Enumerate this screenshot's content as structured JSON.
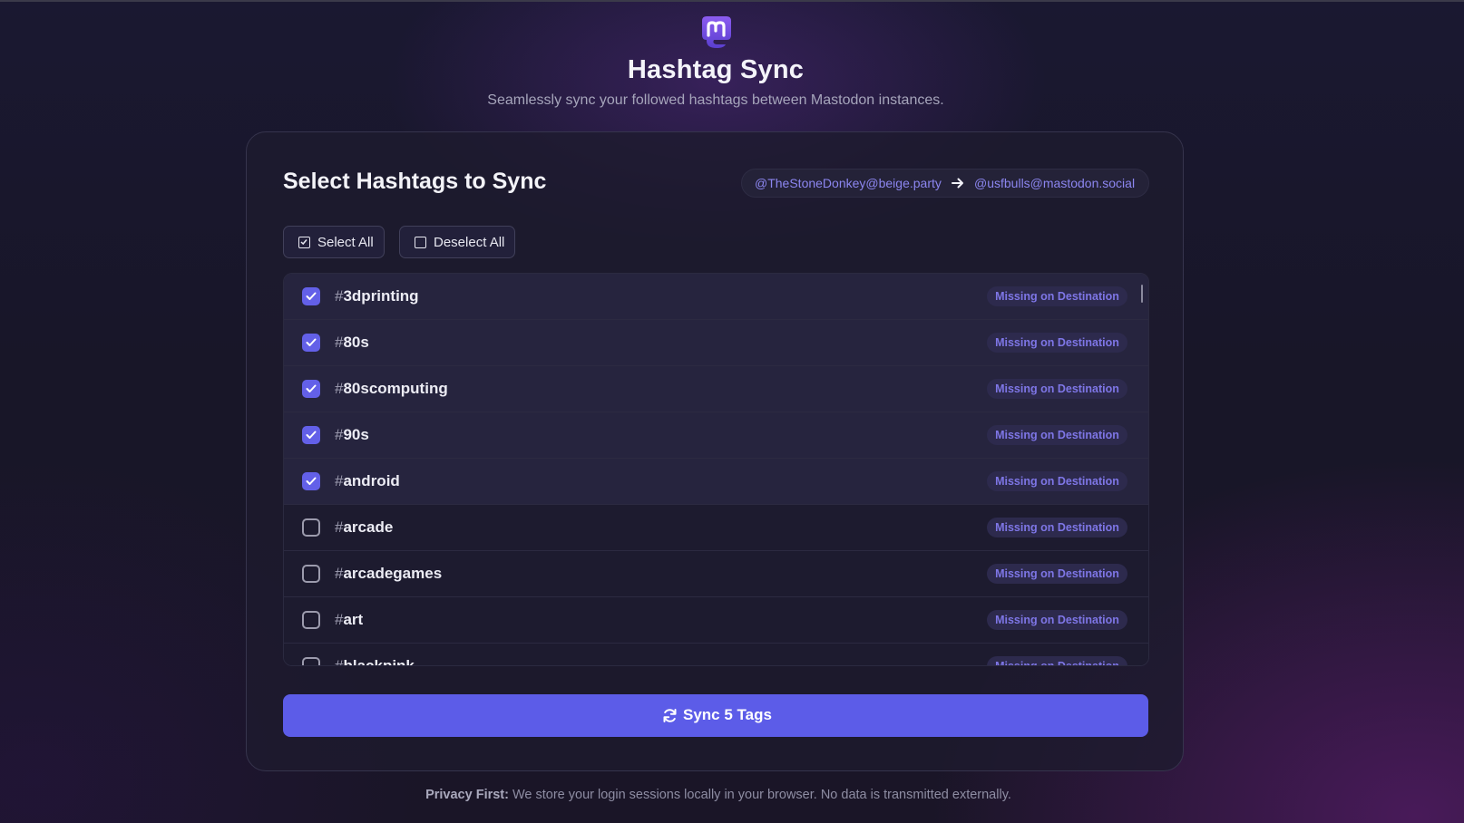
{
  "app": {
    "logo_icon": "mastodon-logo",
    "title": "Hashtag Sync",
    "subtitle": "Seamlessly sync your followed hashtags between Mastodon instances."
  },
  "card": {
    "title": "Select Hashtags to Sync",
    "source_account": "@TheStoneDonkey@beige.party",
    "arrow_icon": "arrow-right-icon",
    "destination_account": "@usfbulls@mastodon.social",
    "select_all_label": "Select All",
    "deselect_all_label": "Deselect All"
  },
  "hashtags": [
    {
      "name": "3dprinting",
      "checked": true,
      "status": "Missing on Destination"
    },
    {
      "name": "80s",
      "checked": true,
      "status": "Missing on Destination"
    },
    {
      "name": "80scomputing",
      "checked": true,
      "status": "Missing on Destination"
    },
    {
      "name": "90s",
      "checked": true,
      "status": "Missing on Destination"
    },
    {
      "name": "android",
      "checked": true,
      "status": "Missing on Destination"
    },
    {
      "name": "arcade",
      "checked": false,
      "status": "Missing on Destination"
    },
    {
      "name": "arcadegames",
      "checked": false,
      "status": "Missing on Destination"
    },
    {
      "name": "art",
      "checked": false,
      "status": "Missing on Destination"
    },
    {
      "name": "blackpink",
      "checked": false,
      "status": "Missing on Destination"
    }
  ],
  "sync_button": {
    "label": "Sync 5 Tags",
    "icon": "refresh-icon"
  },
  "footer": {
    "bold": "Privacy First:",
    "text": " We store your login sessions locally in your browser. No data is transmitted externally."
  },
  "colors": {
    "accent": "#5c5ce8",
    "badge_text": "#7e76e6",
    "background": "#181628"
  }
}
